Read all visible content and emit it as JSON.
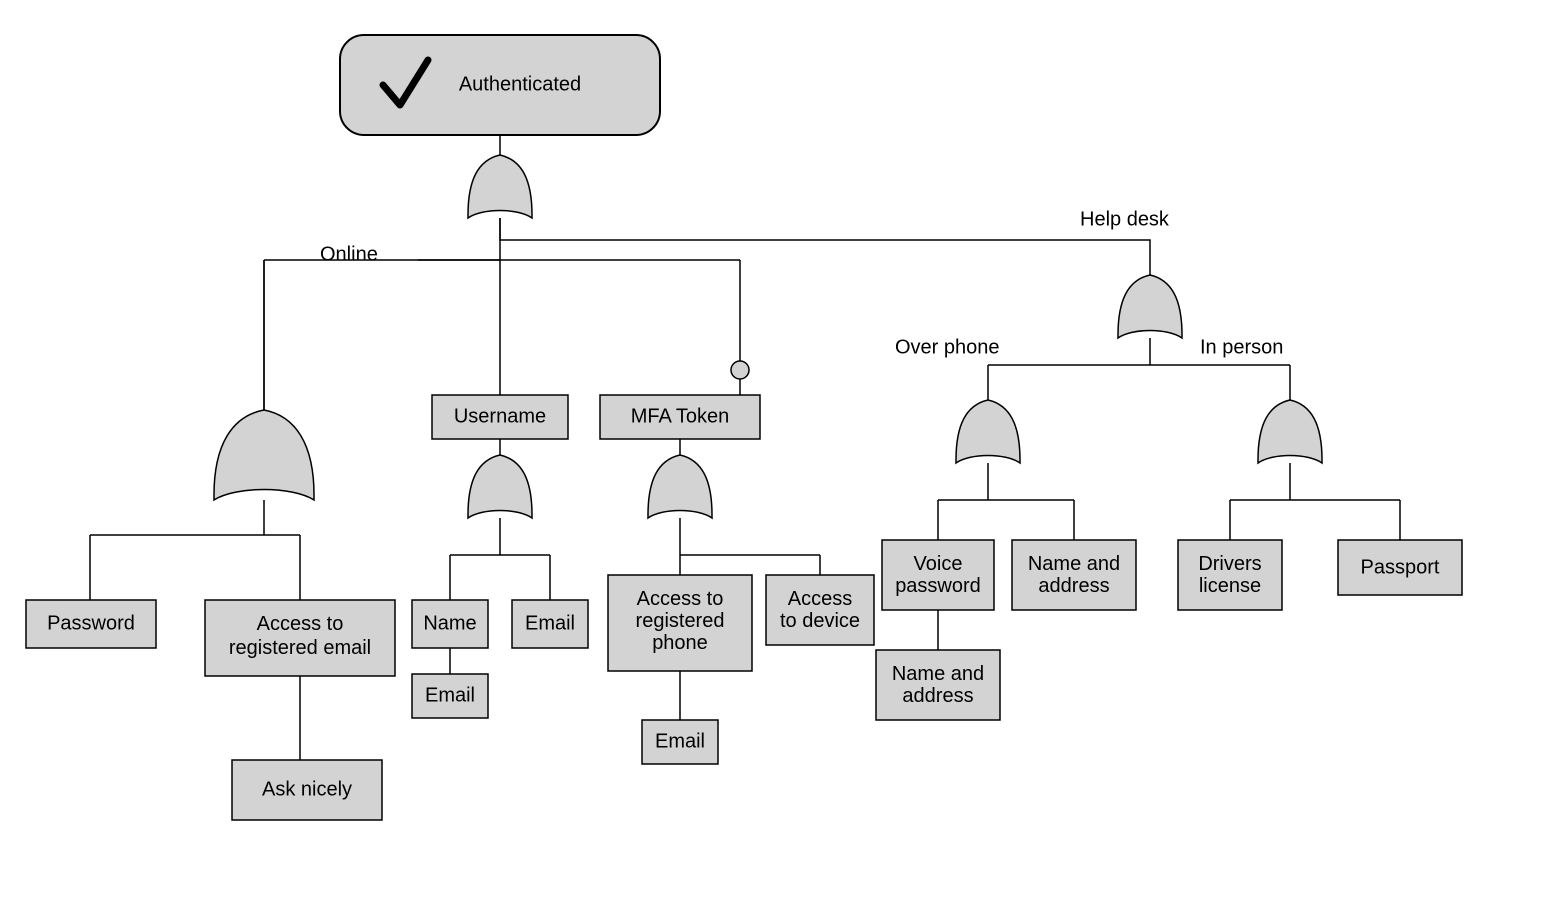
{
  "root": {
    "label": "Authenticated"
  },
  "edge_labels": {
    "online": "Online",
    "helpdesk": "Help desk",
    "over_phone": "Over phone",
    "in_person": "In person"
  },
  "nodes": {
    "password": "Password",
    "access_email": "Access to registered email",
    "ask_nicely": "Ask nicely",
    "username": "Username",
    "name": "Name",
    "email1": "Email",
    "email2": "Email",
    "mfa_token": "MFA Token",
    "access_phone": "Access to registered phone",
    "email3": "Email",
    "access_device": "Access to device",
    "voice_password": "Voice password",
    "name_address1": "Name and address",
    "name_address2": "Name and address",
    "drivers_license": "Drivers license",
    "passport": "Passport"
  },
  "diagram_description": {
    "type": "attack_tree",
    "goal": "Authenticated",
    "structure": {
      "gate": "OR",
      "children": [
        {
          "label": "Online",
          "gate": "AND",
          "children": [
            {
              "gate": "OR",
              "children": [
                "Password",
                {
                  "node": "Access to registered email",
                  "children": [
                    "Ask nicely"
                  ]
                }
              ]
            },
            {
              "node": "Username",
              "gate": "OR",
              "children": [
                "Name",
                {
                  "node": "Email",
                  "children": [
                    "Email"
                  ]
                }
              ]
            },
            {
              "node": "MFA Token",
              "optional": true,
              "gate": "OR",
              "children": [
                {
                  "node": "Access to registered phone",
                  "children": [
                    "Email"
                  ]
                },
                "Access to device"
              ]
            }
          ]
        },
        {
          "label": "Help desk",
          "gate": "OR",
          "children": [
            {
              "label": "Over phone",
              "gate": "OR",
              "children": [
                {
                  "node": "Voice password",
                  "children": [
                    "Name and address"
                  ]
                },
                "Name and address"
              ]
            },
            {
              "label": "In person",
              "gate": "OR",
              "children": [
                "Drivers license",
                "Passport"
              ]
            }
          ]
        }
      ]
    }
  }
}
